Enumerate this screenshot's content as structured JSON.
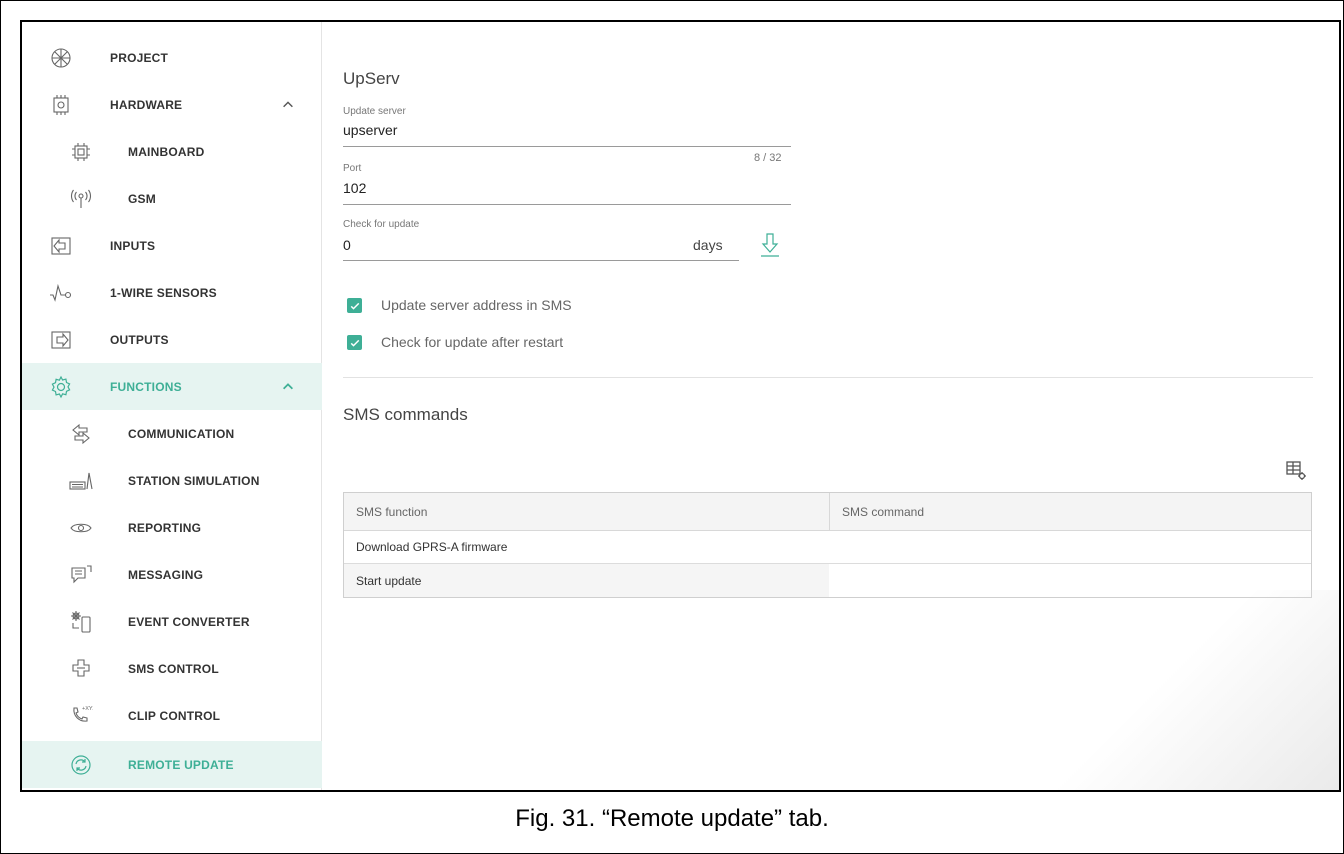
{
  "caption": "Fig. 31. “Remote update” tab.",
  "accent_color": "#3eaf96",
  "sidebar": {
    "items": [
      {
        "label": "PROJECT",
        "icon": "project-icon"
      },
      {
        "label": "HARDWARE",
        "icon": "hardware-icon",
        "expanded": true
      },
      {
        "label": "MAINBOARD",
        "icon": "mainboard-icon"
      },
      {
        "label": "GSM",
        "icon": "antenna-icon"
      },
      {
        "label": "INPUTS",
        "icon": "inputs-icon"
      },
      {
        "label": "1-WIRE SENSORS",
        "icon": "sensor-icon"
      },
      {
        "label": "OUTPUTS",
        "icon": "outputs-icon"
      },
      {
        "label": "FUNCTIONS",
        "icon": "gear-icon",
        "expanded": true
      },
      {
        "label": "COMMUNICATION",
        "icon": "communication-icon"
      },
      {
        "label": "STATION SIMULATION",
        "icon": "station-simulation-icon"
      },
      {
        "label": "REPORTING",
        "icon": "eye-icon"
      },
      {
        "label": "MESSAGING",
        "icon": "messaging-icon"
      },
      {
        "label": "EVENT CONVERTER",
        "icon": "event-converter-icon"
      },
      {
        "label": "SMS CONTROL",
        "icon": "sms-control-icon"
      },
      {
        "label": "CLIP CONTROL",
        "icon": "clip-control-icon"
      },
      {
        "label": "REMOTE UPDATE",
        "icon": "remote-update-icon",
        "active": true
      }
    ]
  },
  "upserv": {
    "title": "UpServ",
    "update_server_label": "Update server",
    "update_server_value": "upserver",
    "update_server_counter": "8 / 32",
    "port_label": "Port",
    "port_value": "102",
    "check_label": "Check for update",
    "check_value": "0",
    "check_suffix": "days",
    "cb1_label": "Update server address in SMS",
    "cb1_checked": true,
    "cb2_label": "Check for update after restart",
    "cb2_checked": true
  },
  "sms": {
    "title": "SMS commands",
    "columns": [
      "SMS function",
      "SMS command"
    ],
    "rows": [
      [
        "Download GPRS-A firmware",
        ""
      ],
      [
        "Start update",
        ""
      ]
    ]
  }
}
